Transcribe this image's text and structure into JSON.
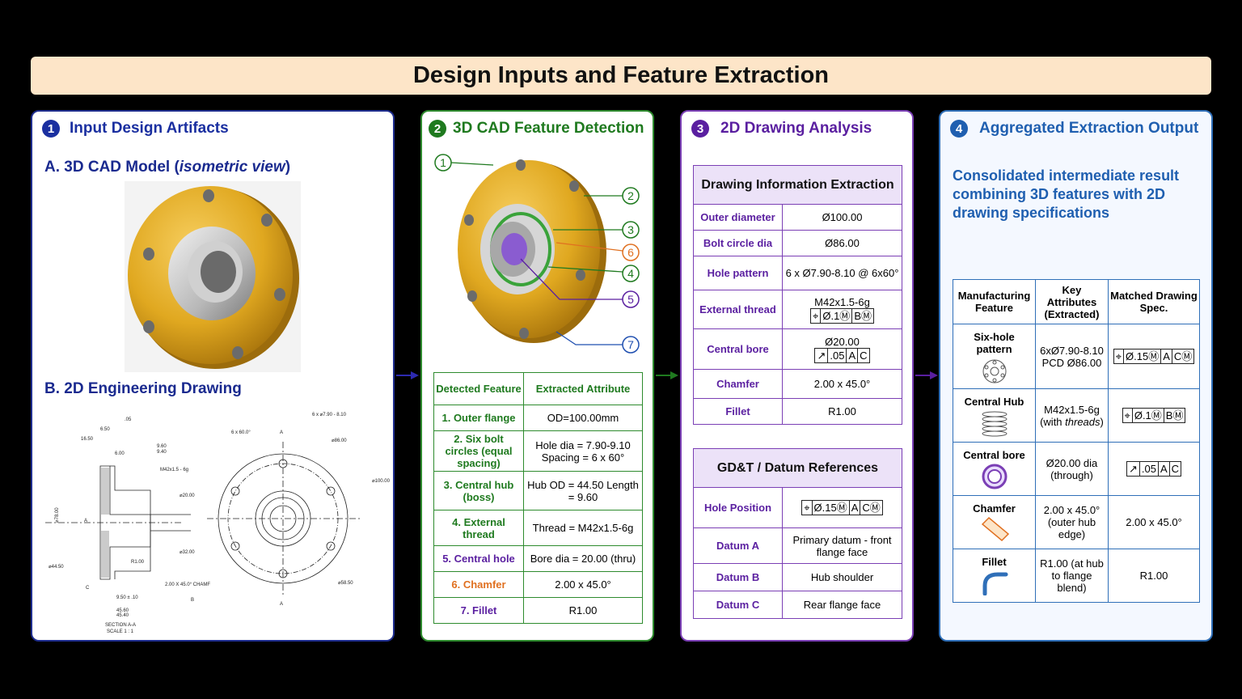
{
  "title": "Design Inputs and Feature Extraction",
  "panel1": {
    "num": "1",
    "title": "Input Design Artifacts",
    "sub_a_prefix": "A. 3D CAD Model (",
    "sub_a_italic": "isometric view",
    "sub_a_suffix": ")",
    "sub_b": "B. 2D Engineering Drawing",
    "drawing": {
      "section_label": "SECTION A-A",
      "scale_label": "SCALE 1 : 1",
      "dims": [
        "6.50",
        "16.50",
        "6.00",
        "9.60",
        "9.40",
        "M42x1.5 - 6g",
        "⌀20.00",
        "⌀32.00",
        "R1.00",
        "2.00 X 45.0° CHAMF",
        "9.50 ± .10",
        "45.60",
        "45.40",
        "⌀44.50",
        "⌀78.00",
        "A",
        "B",
        "C",
        ".05",
        "6 x 60.0°",
        "6 x ⌀7.90 - 8.10",
        "⌀86.00",
        "⌀100.00",
        "⌀58.50"
      ]
    }
  },
  "panel2": {
    "num": "2",
    "title": "3D CAD Feature Detection",
    "callouts": [
      "1",
      "2",
      "3",
      "6",
      "4",
      "5",
      "7"
    ],
    "table_headers": [
      "Detected Feature",
      "Extracted Attribute"
    ],
    "rows": [
      {
        "feature": "1. Outer flange",
        "attr": "OD=100.00mm",
        "color": "green"
      },
      {
        "feature": "2. Six bolt circles (equal spacing)",
        "attr": "Hole dia = 7.90-9.10 Spacing = 6 x 60°",
        "color": "green"
      },
      {
        "feature": "3. Central hub (boss)",
        "attr": "Hub OD = 44.50 Length = 9.60",
        "color": "green"
      },
      {
        "feature": "4. External thread",
        "attr": "Thread = M42x1.5-6g",
        "color": "green"
      },
      {
        "feature": "5. Central hole",
        "attr": "Bore dia = 20.00 (thru)",
        "color": "purple"
      },
      {
        "feature": "6. Chamfer",
        "attr": "2.00 x 45.0°",
        "color": "orange"
      },
      {
        "feature": "7. Fillet",
        "attr": "R1.00",
        "color": "purple"
      }
    ]
  },
  "panel3": {
    "num": "3",
    "title": "2D Drawing Analysis",
    "info_title": "Drawing Information Extraction",
    "info_rows": [
      {
        "label": "Outer diameter",
        "value": "Ø100.00"
      },
      {
        "label": "Bolt circle dia",
        "value": "Ø86.00"
      },
      {
        "label": "Hole pattern",
        "value": "6 x Ø7.90-8.10 @ 6x60°"
      },
      {
        "label": "External thread",
        "value": "M42x1.5-6g"
      },
      {
        "label": "Central bore",
        "value": "Ø20.00"
      },
      {
        "label": "Chamfer",
        "value": "2.00 x 45.0°"
      },
      {
        "label": "Fillet",
        "value": "R1.00"
      }
    ],
    "gdt_title": "GD&T / Datum References",
    "gdt_rows": [
      {
        "label": "Hole Position",
        "value": ""
      },
      {
        "label": "Datum A",
        "value": "Primary datum - front flange face"
      },
      {
        "label": "Datum B",
        "value": "Hub shoulder"
      },
      {
        "label": "Datum C",
        "value": "Rear flange face"
      }
    ],
    "fcf": {
      "thread": [
        "⌖",
        "Ø.1Ⓜ",
        "BⓂ"
      ],
      "bore": [
        "↗",
        ".05",
        "A",
        "C"
      ],
      "hole": [
        "⌖",
        "Ø.15Ⓜ",
        "A",
        "CⓂ"
      ]
    }
  },
  "panel4": {
    "num": "4",
    "title": "Aggregated Extraction Output",
    "description": "Consolidated intermediate result combining 3D features with 2D drawing specifications",
    "headers": [
      "Manufacturing Feature",
      "Key Attributes (Extracted)",
      "Matched Drawing Spec."
    ],
    "rows": [
      {
        "feature": "Six-hole pattern",
        "attr": "6xØ7.90-8.10 PCD Ø86.00",
        "spec": ""
      },
      {
        "feature": "Central Hub",
        "attr_pre": "M42x1.5-6g (with ",
        "attr_it": "threads",
        "attr_post": ")",
        "spec": ""
      },
      {
        "feature": "Central bore",
        "attr": "Ø20.00 dia (through)",
        "spec": ""
      },
      {
        "feature": "Chamfer",
        "attr": "2.00 x 45.0° (outer hub edge)",
        "spec": "2.00 x 45.0°"
      },
      {
        "feature": "Fillet",
        "attr": "R1.00 (at hub to flange blend)",
        "spec": "R1.00"
      }
    ]
  },
  "colors": {
    "banner": "#fde5c8",
    "blue": "#1a2fa0",
    "green": "#1f7a1f",
    "purple": "#5a1fa0",
    "orange": "#e07020",
    "gold": "#e0a820"
  },
  "icons": [
    "bullseye-icon",
    "coil-icon",
    "ring-icon",
    "chamfer-icon",
    "fillet-icon"
  ]
}
